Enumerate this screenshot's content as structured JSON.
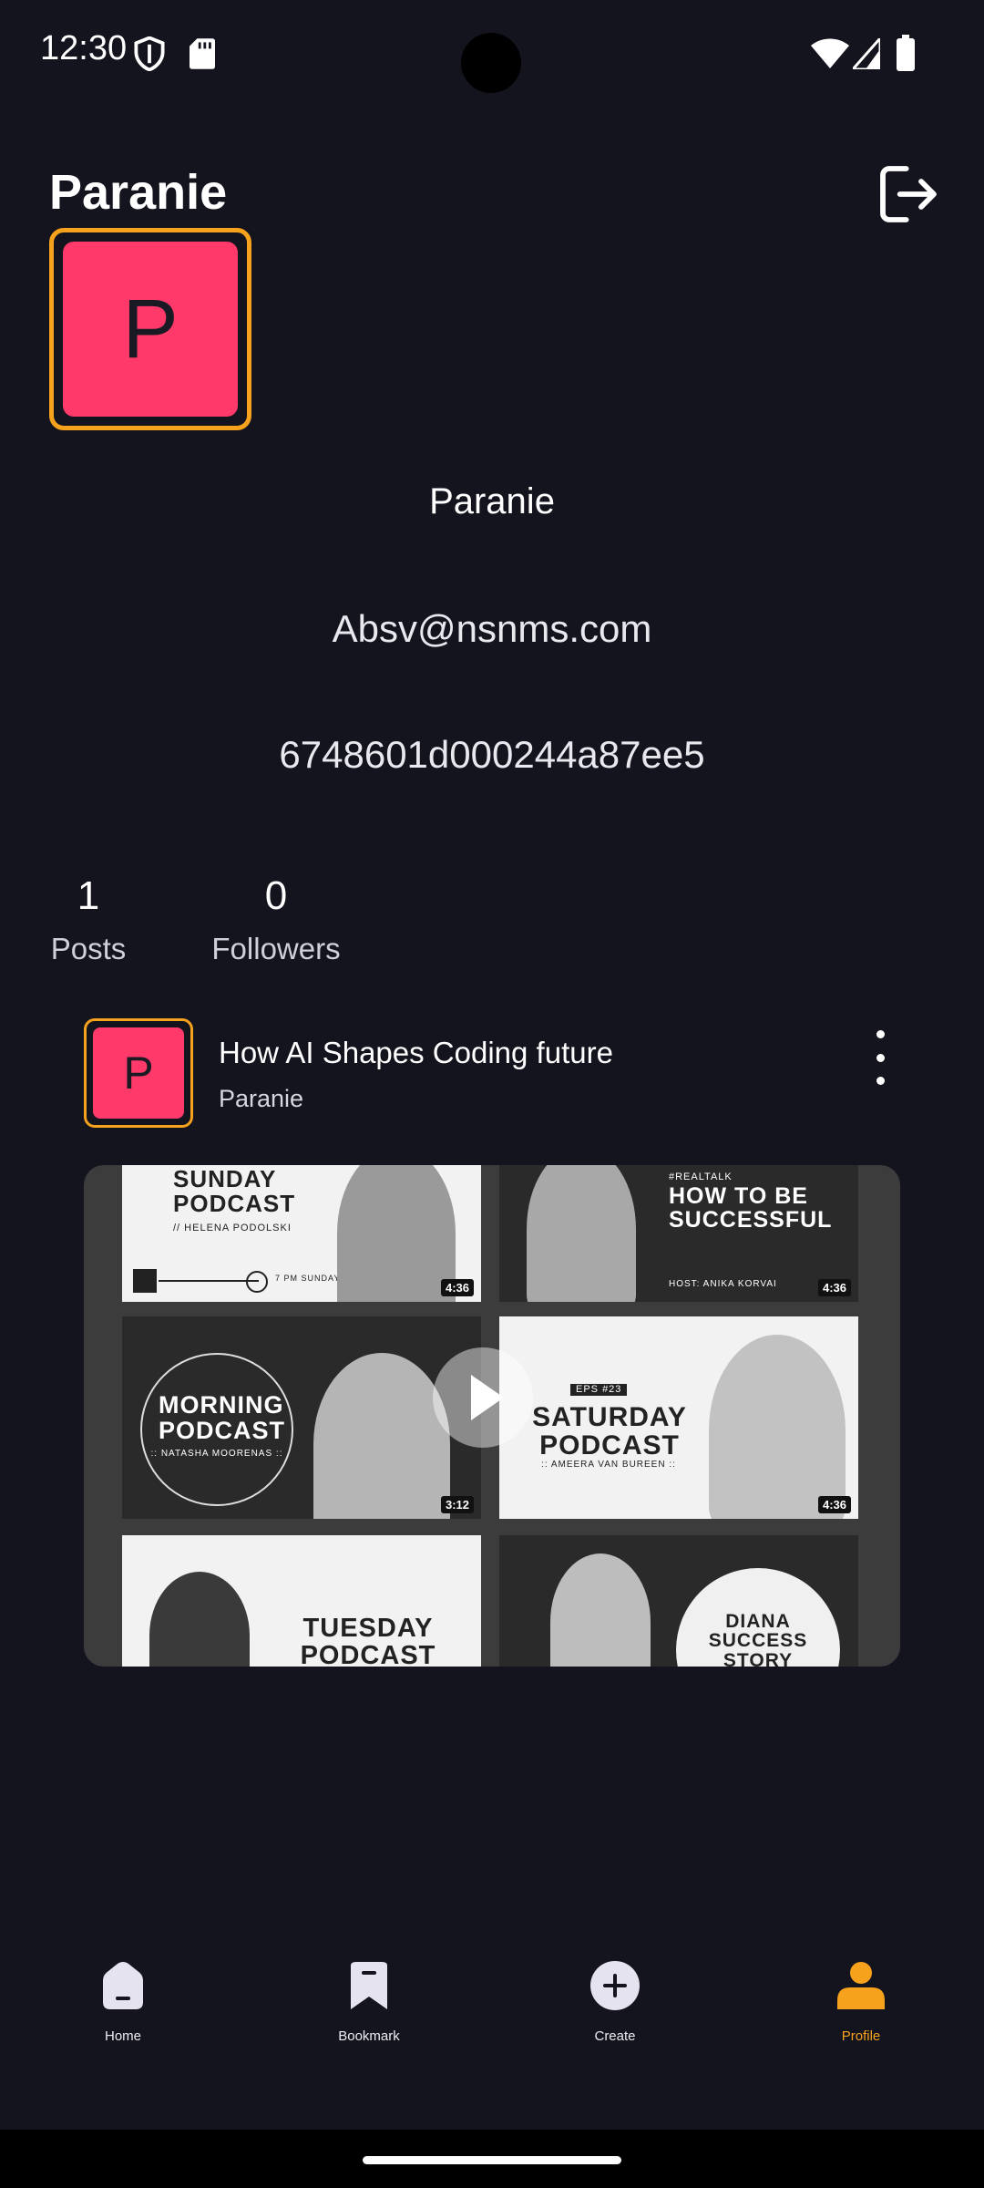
{
  "status_bar": {
    "time": "12:30"
  },
  "header": {
    "title": "Paranie",
    "logout_icon": "logout-icon"
  },
  "profile": {
    "avatar_letter": "P",
    "name": "Paranie",
    "email": "Absv@nsnms.com",
    "id": "6748601d000244a87ee5"
  },
  "stats": [
    {
      "value": "1",
      "label": "Posts"
    },
    {
      "value": "0",
      "label": "Followers"
    }
  ],
  "post": {
    "avatar_letter": "P",
    "title": "How AI Shapes Coding future",
    "author": "Paranie",
    "media": {
      "t1": {
        "title": "SUNDAY\nPODCAST",
        "sub": "// HELENA PODOLSKI",
        "extra": "7 PM SUNDAY",
        "duration": "4:36"
      },
      "t2": {
        "tag": "#REALTALK",
        "title": "HOW TO BE\nSUCCESSFUL",
        "sub": "HOST: ANIKA KORVAI",
        "duration": "4:36"
      },
      "t3": {
        "title": "MORNING\nPODCAST",
        "sub": ":: NATASHA MOORENAS ::",
        "duration": "3:12"
      },
      "t4": {
        "tag": "EPS #23",
        "title": "SATURDAY\nPODCAST",
        "sub": ":: AMEERA VAN BUREEN ::",
        "duration": "4:36"
      },
      "t5": {
        "title": "TUESDAY\nPODCAST"
      },
      "t6": {
        "title": "DIANA\nSUCCESS\nSTORY"
      }
    }
  },
  "nav": [
    {
      "label": "Home",
      "icon": "home-icon"
    },
    {
      "label": "Bookmark",
      "icon": "bookmark-icon"
    },
    {
      "label": "Create",
      "icon": "add-circle-icon"
    },
    {
      "label": "Profile",
      "icon": "person-icon",
      "active": true
    }
  ],
  "colors": {
    "background": "#14141f",
    "accent": "#f7a21c",
    "avatar": "#ff3a6b"
  }
}
